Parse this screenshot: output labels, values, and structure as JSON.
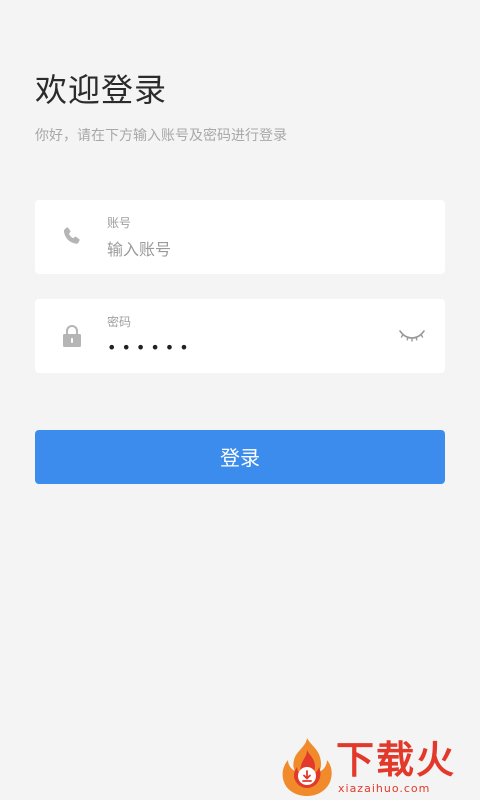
{
  "header": {
    "title": "欢迎登录",
    "subtitle": "你好，请在下方输入账号及密码进行登录"
  },
  "account": {
    "label": "账号",
    "placeholder": "输入账号",
    "value": "",
    "icon": "phone-icon"
  },
  "password": {
    "label": "密码",
    "masked_value": "••••••",
    "icon": "lock-icon",
    "toggle_icon": "eye-closed-icon"
  },
  "login_button": {
    "label": "登录",
    "color": "#3b8ced"
  },
  "watermark": {
    "text": "下载火",
    "url": "xiazaihuo.com",
    "color": "#e2392a"
  },
  "colors": {
    "background": "#f4f4f5",
    "card": "#ffffff",
    "title": "#2b2b2b",
    "subtitle": "#a8a8a8",
    "icon": "#b5b5b5"
  }
}
